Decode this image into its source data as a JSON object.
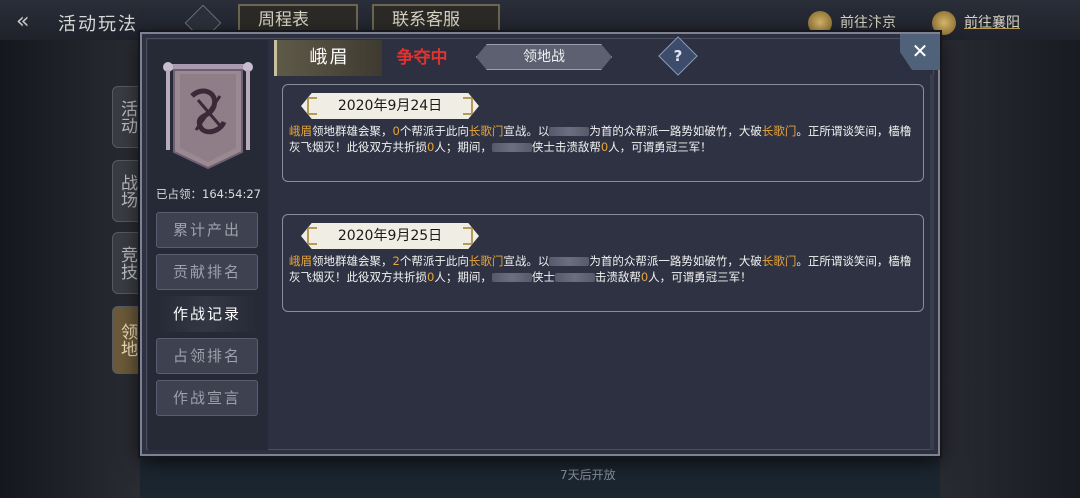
{
  "background": {
    "title": "活动玩法",
    "tabs": [
      "周程表",
      "联系客服"
    ],
    "goto_buttons": [
      "前往汴京",
      "前往襄阳"
    ],
    "side_tabs": [
      "活动",
      "战场",
      "竞技",
      "领地"
    ],
    "bottom_text": "7天后开放"
  },
  "modal": {
    "close_label": "✕",
    "occupied_label": "已占领：164:54:27",
    "side_buttons": [
      "累计产出",
      "贡献排名",
      "作战记录",
      "占领排名",
      "作战宣言"
    ],
    "active_side_button": "作战记录",
    "header": {
      "territory": "峨眉",
      "status": "争夺中",
      "tab": "领地战",
      "help": "?"
    },
    "records": [
      {
        "date": "2020年9月24日",
        "territory": "峨眉",
        "t1": "领地群雄会聚，",
        "count": "0",
        "t2": "个帮派于此向",
        "faction": "长歌门",
        "t3": "宣战。以",
        "t4": "为首的众帮派一路势如破竹，大破",
        "faction2": "长歌门",
        "t5": "。正所谓谈笑间，樯橹灰飞烟灭！此役双方共折损",
        "loss": "0",
        "t6": "人；期间，",
        "t7": "侠士击溃敌帮",
        "kills": "0",
        "t8": "人，可谓勇冠三军！"
      },
      {
        "date": "2020年9月25日",
        "territory": "峨眉",
        "t1": "领地群雄会聚，",
        "count": "2",
        "t2": "个帮派于此向",
        "faction": "长歌门",
        "t3": "宣战。以",
        "t4": "为首的众帮派一路势如破竹，大破",
        "faction2": "长歌门",
        "t5": "。正所谓谈笑间，樯橹灰飞烟灭！此役双方共折损",
        "loss": "0",
        "t6": "人；期间，",
        "t7": "侠士",
        "t7b": "击溃敌帮",
        "kills": "0",
        "t8": "人，可谓勇冠三军！"
      }
    ]
  },
  "colors": {
    "highlight": "#e8a53c",
    "status_red": "#e0322e",
    "panel": "#2c3040"
  }
}
